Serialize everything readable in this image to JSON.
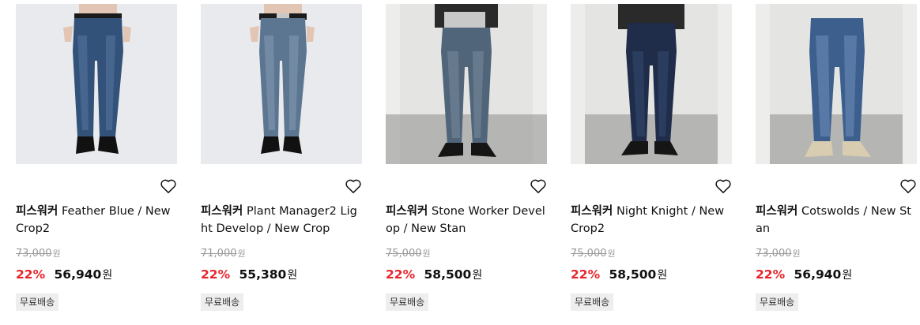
{
  "products": [
    {
      "brand": "피스워커",
      "title": "Feather Blue / New Crop2",
      "original_price": "73,000",
      "currency": "원",
      "discount": "22%",
      "sale_price": "56,940",
      "shipping": "무료배송",
      "image_icon": "product-image",
      "wishlist_icon": "heart-icon"
    },
    {
      "brand": "피스워커",
      "title": "Plant Manager2 Light Develop / New Crop",
      "original_price": "71,000",
      "currency": "원",
      "discount": "22%",
      "sale_price": "55,380",
      "shipping": "무료배송",
      "image_icon": "product-image",
      "wishlist_icon": "heart-icon"
    },
    {
      "brand": "피스워커",
      "title": "Stone Worker Develop / New Stan",
      "original_price": "75,000",
      "currency": "원",
      "discount": "22%",
      "sale_price": "58,500",
      "shipping": "무료배송",
      "image_icon": "product-image",
      "wishlist_icon": "heart-icon"
    },
    {
      "brand": "피스워커",
      "title": "Night Knight / New Crop2",
      "original_price": "75,000",
      "currency": "원",
      "discount": "22%",
      "sale_price": "58,500",
      "shipping": "무료배송",
      "image_icon": "product-image",
      "wishlist_icon": "heart-icon"
    },
    {
      "brand": "피스워커",
      "title": "Cotswolds / New Stan",
      "original_price": "73,000",
      "currency": "원",
      "discount": "22%",
      "sale_price": "56,940",
      "shipping": "무료배송",
      "image_icon": "product-image",
      "wishlist_icon": "heart-icon"
    }
  ],
  "colors": {
    "discount": "#e8242c",
    "strike_price": "#999999",
    "badge_bg": "#eeeeee"
  }
}
